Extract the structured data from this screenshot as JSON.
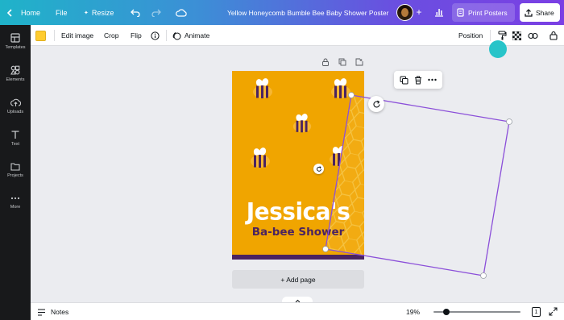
{
  "topbar": {
    "home_label": "Home",
    "file_label": "File",
    "resize_label": "Resize",
    "doc_title": "Yellow Honeycomb Bumble Bee Baby Shower Poster",
    "print_label": "Print Posters",
    "share_label": "Share",
    "plus": "+"
  },
  "sidebar": {
    "items": [
      {
        "label": "Templates",
        "icon": "templates-icon"
      },
      {
        "label": "Elements",
        "icon": "elements-icon"
      },
      {
        "label": "Uploads",
        "icon": "uploads-icon"
      },
      {
        "label": "Text",
        "icon": "text-icon"
      },
      {
        "label": "Projects",
        "icon": "projects-icon"
      },
      {
        "label": "More",
        "icon": "more-icon"
      }
    ]
  },
  "toolbar": {
    "edit_image": "Edit image",
    "crop": "Crop",
    "flip": "Flip",
    "animate": "Animate",
    "position": "Position",
    "fill_color": "#ffcc2f"
  },
  "poster": {
    "headline": "Jessica's",
    "subhead": "Ba-bee Shower",
    "background": "#f0a500",
    "band_color": "#4a2360"
  },
  "canvas": {
    "add_page": "+ Add page",
    "selection_color": "#8b4fd9"
  },
  "footer": {
    "notes": "Notes",
    "zoom": "19%",
    "page_count": "1",
    "zoom_level": 0.19
  }
}
